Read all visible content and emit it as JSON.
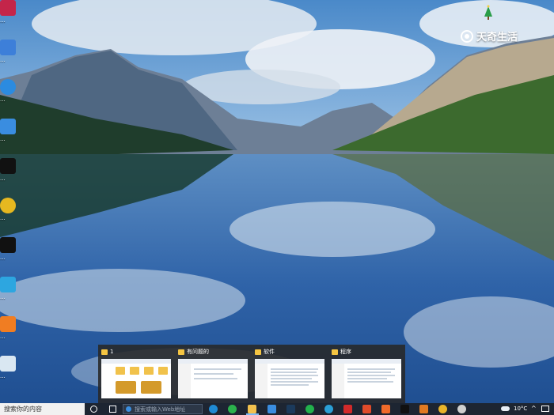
{
  "desktop_icons": [
    {
      "name": "app-icon-1",
      "label": "...",
      "color": "#c4254a"
    },
    {
      "name": "app-icon-2",
      "label": "...",
      "color": "#3d7fd9"
    },
    {
      "name": "app-icon-3",
      "label": "...",
      "color": "#2b8be0"
    },
    {
      "name": "app-icon-4",
      "label": "...",
      "color": "#3a8de0"
    },
    {
      "name": "app-icon-5",
      "label": "...",
      "color": "#111111"
    },
    {
      "name": "app-icon-6",
      "label": "...",
      "color": "#e6b820"
    },
    {
      "name": "app-icon-7",
      "label": "...",
      "color": "#111111"
    },
    {
      "name": "app-icon-8",
      "label": "...",
      "color": "#2da6e0"
    },
    {
      "name": "app-icon-9",
      "label": "...",
      "color": "#f07d22"
    },
    {
      "name": "app-icon-10",
      "label": "...",
      "color": "#d9e7f2"
    }
  ],
  "watermark": {
    "text": "天奇生活"
  },
  "task_switcher": {
    "windows": [
      {
        "title": "1"
      },
      {
        "title": "有问题的"
      },
      {
        "title": "软件"
      },
      {
        "title": "程序"
      }
    ]
  },
  "taskbar": {
    "search_placeholder": "搜索你的内容",
    "edge_address": "搜索或输入Web地址",
    "temperature": "10°C",
    "app_icons": [
      {
        "name": "tb-edge-icon",
        "color": "#1f8ad3"
      },
      {
        "name": "tb-wechat-icon",
        "color": "#2bb24c"
      },
      {
        "name": "tb-explorer-icon",
        "color": "#f2c14e"
      },
      {
        "name": "tb-store-icon",
        "color": "#3a8de0"
      },
      {
        "name": "tb-ps-icon",
        "color": "#1b3a5c"
      },
      {
        "name": "tb-chat-icon",
        "color": "#22b14c"
      },
      {
        "name": "tb-browser-icon",
        "color": "#2a9fd6"
      },
      {
        "name": "tb-app-icon",
        "color": "#5b6b80"
      },
      {
        "name": "tb-wps-icon",
        "color": "#d22a2a"
      },
      {
        "name": "tb-red-icon",
        "color": "#e04b2a"
      },
      {
        "name": "tb-orange-icon",
        "color": "#f06a2a"
      },
      {
        "name": "tb-capcut-icon",
        "color": "#111111"
      },
      {
        "name": "tb-game-icon",
        "color": "#e07a22"
      },
      {
        "name": "tb-chrome-icon",
        "color": "#e8b42a"
      },
      {
        "name": "tb-settings-icon",
        "color": "#d0d0d0"
      }
    ]
  }
}
